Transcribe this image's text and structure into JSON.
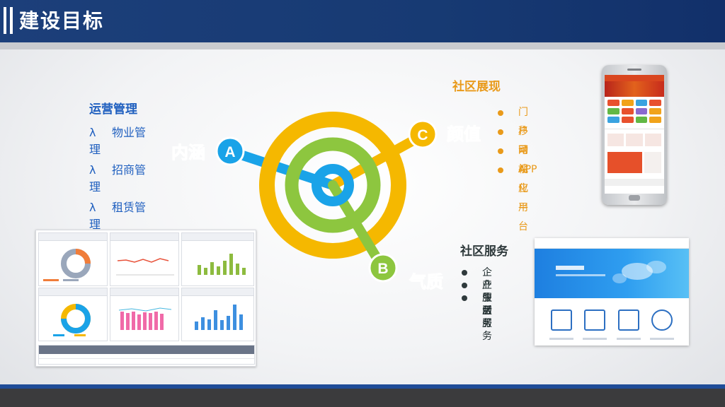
{
  "header": {
    "title": "建设目标"
  },
  "operations": {
    "heading": "运营管理",
    "items": [
      {
        "bullet": "λ",
        "line1": "物业管",
        "line2": "理"
      },
      {
        "bullet": "λ",
        "line1": "招商管",
        "line2": "理"
      },
      {
        "bullet": "λ",
        "line1": "租赁管",
        "line2": "理"
      }
    ]
  },
  "target": {
    "a": {
      "letter": "A",
      "label": "内涵"
    },
    "b": {
      "letter": "B",
      "label": "气质"
    },
    "c": {
      "letter": "C",
      "label": "颜值"
    }
  },
  "showcase": {
    "heading": "社区展现",
    "items": [
      "门户网站",
      "移动 APP",
      "可视化平台",
      "AI 应用"
    ]
  },
  "service": {
    "heading": "社区服务",
    "items": [
      "企业服务",
      "产业服务",
      "生活服务"
    ]
  },
  "colors": {
    "header": "#1c3f7a",
    "blue": "#1aa3e8",
    "green": "#8dc63f",
    "yellow": "#f5b800",
    "orange": "#e99a1a",
    "headingBlue": "#1f5fbf"
  }
}
